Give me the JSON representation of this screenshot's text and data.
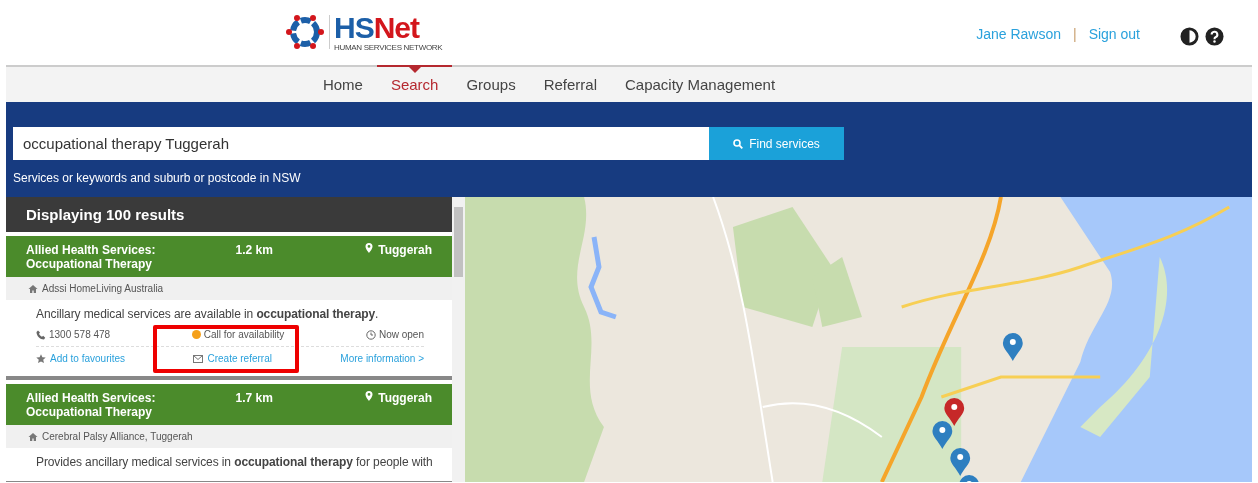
{
  "header": {
    "logo_parts": [
      "HS",
      "Net"
    ],
    "tagline": "HUMAN SERVICES NETWORK",
    "user": "Jane Rawson",
    "separator": "|",
    "sign_out": "Sign out"
  },
  "nav": [
    {
      "label": "Home",
      "selected": false
    },
    {
      "label": "Search",
      "selected": true
    },
    {
      "label": "Groups",
      "selected": false
    },
    {
      "label": "Referral",
      "selected": false
    },
    {
      "label": "Capacity Management",
      "selected": false
    }
  ],
  "search": {
    "value": "occupational therapy Tuggerah",
    "button": "Find services",
    "hint": "Services or keywords and suburb or postcode in NSW"
  },
  "results": {
    "heading": "Displaying 100 results",
    "items": [
      {
        "title": "Allied Health Services: Occupational Therapy",
        "distance": "1.2 km",
        "suburb": "Tuggerah",
        "provider": "Adssi HomeLiving Australia",
        "description": "Ancillary medical services are available in **occupational therapy**.",
        "phone": "1300 578 478",
        "availability": {
          "label": "Call for availability",
          "color": "#f5a01a"
        },
        "hours": "Now open",
        "actions": [
          "Add to favourites",
          "Create referral",
          "More information >"
        ]
      },
      {
        "title": "Allied Health Services: Occupational Therapy",
        "distance": "1.7 km",
        "suburb": "Tuggerah",
        "provider": "Cerebral Palsy Alliance, Tuggerah",
        "description": "Provides ancillary medical services in **occupational therapy** for people with"
      }
    ]
  },
  "annotation": {
    "kind": "rectangle"
  }
}
